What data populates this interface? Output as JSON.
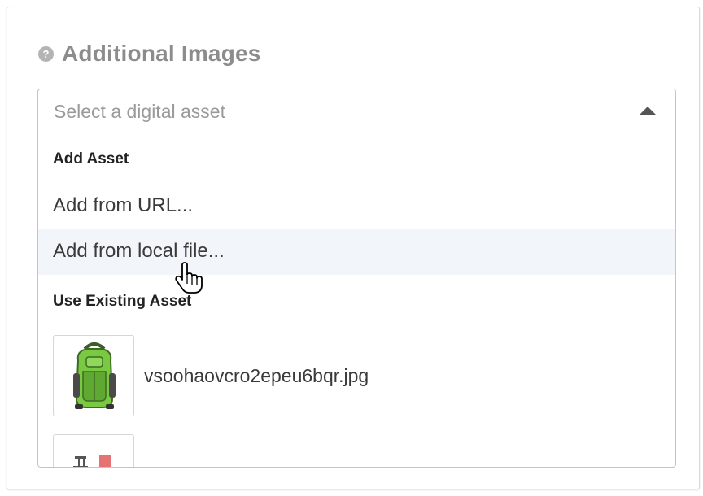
{
  "section": {
    "title": "Additional Images",
    "help_icon": "question-circle-icon"
  },
  "select": {
    "placeholder": "Select a digital asset",
    "caret_icon": "caret-up-icon",
    "expanded": true
  },
  "menu": {
    "add_group_label": "Add Asset",
    "add_items": [
      {
        "label": "Add from URL..."
      },
      {
        "label": "Add from local file...",
        "highlighted": true
      }
    ],
    "existing_group_label": "Use Existing Asset",
    "existing_items": [
      {
        "name": "vsoohaovcro2epeu6bqr.jpg",
        "thumbnail": "green-backpack-image"
      },
      {
        "name": "",
        "thumbnail": "partial-asset-thumbnail"
      }
    ]
  },
  "cursor": {
    "icon": "hand-pointer-cursor-icon"
  },
  "colors": {
    "highlight": "#f2f6fb",
    "title": "#8c8c8c",
    "backpack_green": "#7ac943"
  }
}
